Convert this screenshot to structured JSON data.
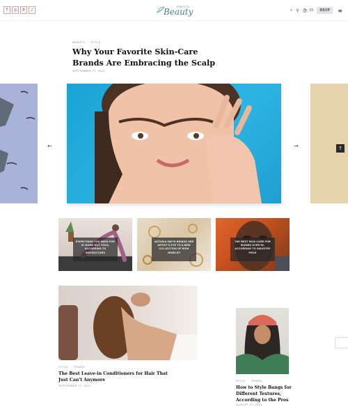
{
  "header": {
    "social_icons": [
      {
        "name": "facebook-icon",
        "glyph": "f"
      },
      {
        "name": "instagram-icon",
        "glyph": "◎"
      },
      {
        "name": "pinterest-icon",
        "glyph": "℗"
      },
      {
        "name": "tiktok-icon",
        "glyph": "♪"
      }
    ],
    "logo_small": "PRESTO",
    "logo_main": "Beauty",
    "search_icon": "⌕",
    "user_icon": "⚲",
    "cart_icon": "🛍",
    "cart_count": "(0)",
    "rsvp_label": "RSVP",
    "menu_icon": "≡"
  },
  "article": {
    "category_1": "BEAUTY",
    "category_2": "STYLE",
    "title": "Why Your Favorite Skin-Care Brands Are Embracing the Scalp",
    "date": "SEPTEMBER 27, 2021"
  },
  "carousel": {
    "prev_arrow": "←",
    "next_arrow": "→"
  },
  "scroll_top": "↑",
  "cards": [
    {
      "text": "Everything You Need for At-Home Hot Yoga, According to Instructors"
    },
    {
      "text": "Antonia Smith Brings Her Artist's Eye to a New Collection of High Jewelry"
    },
    {
      "text": "The Best Skin Care for Women Over 50, According to Industry Pros"
    }
  ],
  "posts": [
    {
      "category_1": "STYLE",
      "category_2": "TRAVEL",
      "title": "The Best Leave-in Conditioners for Hair That Just Can't Anymore",
      "date": "SEPTEMBER 27, 2021"
    },
    {
      "category_1": "STYLE",
      "category_2": "TRAVEL",
      "title": "How to Style Bangs for Different Textures, According to the Pros",
      "date": "AUGUST 27, 2021"
    }
  ],
  "colors": {
    "accent": "#3e7e9c",
    "slide_bg": "#1ca3d6",
    "rsvp_bg": "#dfe4e6"
  }
}
